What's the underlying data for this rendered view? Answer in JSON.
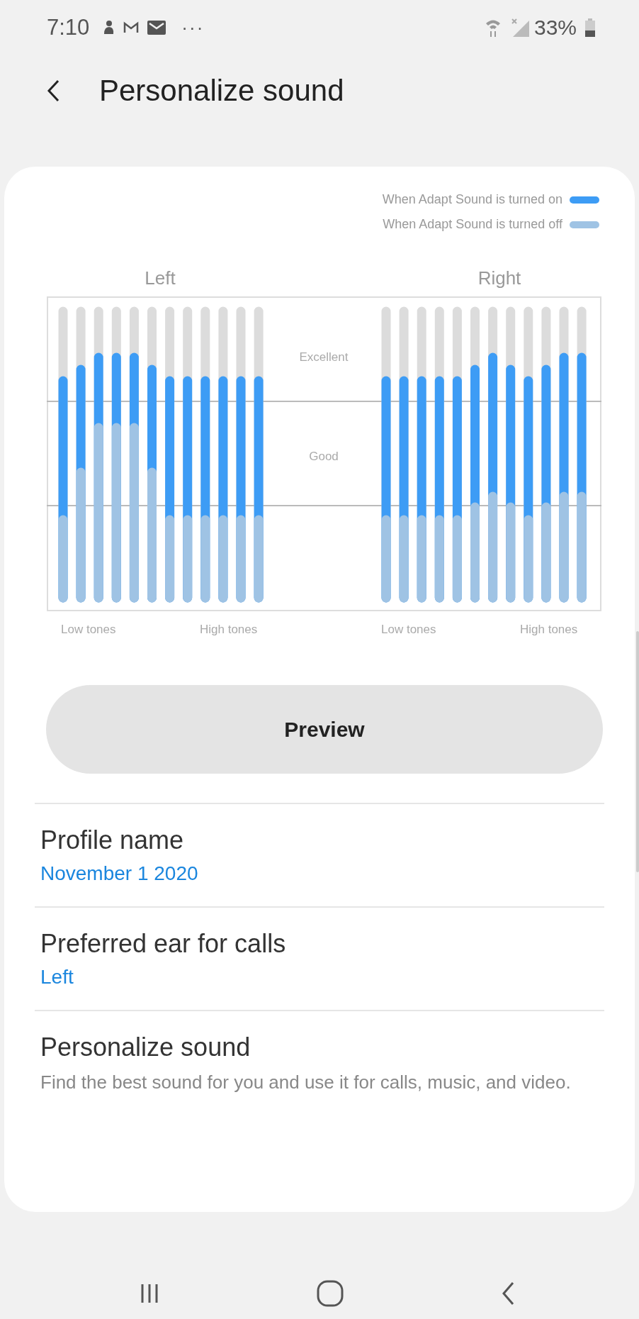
{
  "status_bar": {
    "time": "7:10",
    "more": "···",
    "battery": "33%"
  },
  "header": {
    "title": "Personalize sound"
  },
  "legend": [
    {
      "label": "When Adapt Sound is turned on",
      "color": "#3d9cf5"
    },
    {
      "label": "When Adapt Sound is turned off",
      "color": "#9fc3e4"
    }
  ],
  "chart": {
    "left_label": "Left",
    "right_label": "Right",
    "upper_band": "Excellent",
    "middle_band": "Good",
    "axis_labels": [
      "Low tones",
      "High tones",
      "Low tones",
      "High tones"
    ]
  },
  "preview_button": "Preview",
  "settings": [
    {
      "kind": "value",
      "title": "Profile name",
      "value": "November 1 2020"
    },
    {
      "kind": "value",
      "title": "Preferred ear for calls",
      "value": "Left"
    },
    {
      "kind": "description",
      "title": "Personalize sound",
      "description": "Find the best sound for you and use it for calls, music, and video."
    }
  ]
}
